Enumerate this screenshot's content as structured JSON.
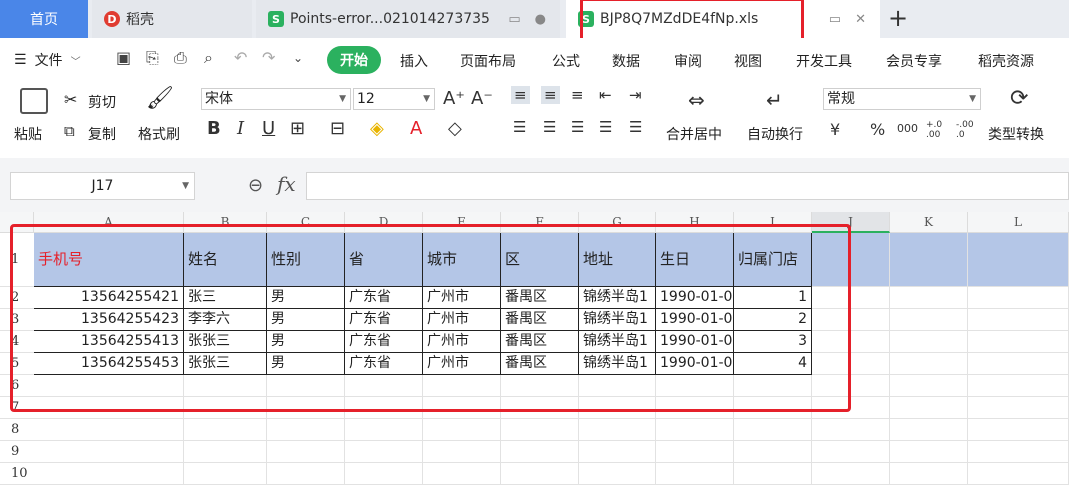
{
  "tabs": {
    "home": "首页",
    "t1": "稻壳",
    "t2": "Points-error...021014273735",
    "t3": "BJP8Q7MZdDE4fNp.xls",
    "new": "+"
  },
  "menu": {
    "file": "文件",
    "items": [
      "开始",
      "插入",
      "页面布局",
      "公式",
      "数据",
      "审阅",
      "视图",
      "开发工具",
      "会员专享",
      "稻壳资源"
    ]
  },
  "ribbon": {
    "paste": "粘贴",
    "cut": "剪切",
    "copy": "复制",
    "format_painter": "格式刷",
    "font_name": "宋体",
    "font_size": "12",
    "merge": "合并居中",
    "wrap": "自动换行",
    "number_format": "常规",
    "type_convert": "类型转换",
    "currency": "¥",
    "percent": "%",
    "thousands": "000",
    "inc_decimal": "+.0 .00",
    "dec_decimal": "-.00 .0"
  },
  "formula_bar": {
    "name_box": "J17",
    "fx": "fx",
    "value": ""
  },
  "sheet": {
    "columns": [
      "A",
      "B",
      "C",
      "D",
      "E",
      "F",
      "G",
      "H",
      "I",
      "J",
      "K",
      "L"
    ],
    "rows": [
      "1",
      "2",
      "3",
      "4",
      "5",
      "6",
      "7",
      "8",
      "9",
      "10"
    ],
    "header": [
      "手机号",
      "姓名",
      "性别",
      "省",
      "城市",
      "区",
      "地址",
      "生日",
      "归属门店"
    ],
    "data": [
      [
        "13564255421",
        "张三",
        "男",
        "广东省",
        "广州市",
        "番禺区",
        "锦绣半岛1",
        "1990-01-0",
        "1"
      ],
      [
        "13564255423",
        "李李六",
        "男",
        "广东省",
        "广州市",
        "番禺区",
        "锦绣半岛1",
        "1990-01-0",
        "2"
      ],
      [
        "13564255413",
        "张张三",
        "男",
        "广东省",
        "广州市",
        "番禺区",
        "锦绣半岛1",
        "1990-01-0",
        "3"
      ],
      [
        "13564255453",
        "张张三",
        "男",
        "广东省",
        "广州市",
        "番禺区",
        "锦绣半岛1",
        "1990-01-0",
        "4"
      ]
    ]
  },
  "colors": {
    "accent_green": "#2bb15f",
    "header_fill": "#b4c6e7",
    "highlight_red": "#e5202a",
    "phone_header_text": "#e5202a"
  }
}
